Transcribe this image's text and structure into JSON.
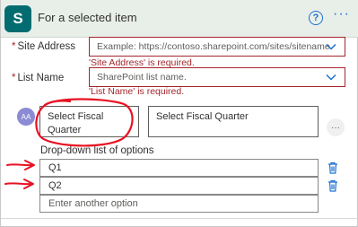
{
  "header": {
    "title": "For a selected item",
    "logo_letter": "S",
    "help_symbol": "?",
    "more_symbol": "···"
  },
  "site_address": {
    "label": "Site Address",
    "required_mark": "*",
    "placeholder": "Example: https://contoso.sharepoint.com/sites/sitename.",
    "error": "'Site Address' is required."
  },
  "list_name": {
    "label": "List Name",
    "required_mark": "*",
    "placeholder": "SharePoint list name.",
    "error": "'List Name' is required."
  },
  "field": {
    "avatar": "AA",
    "name_line1": "Select Fiscal",
    "name_line2": "Quarter",
    "value": "Select Fiscal Quarter",
    "menu_symbol": "···"
  },
  "options": {
    "label": "Drop-down list of options",
    "items": [
      "Q1",
      "Q2"
    ],
    "add_placeholder": "Enter another option"
  },
  "colors": {
    "error": "#a4262c",
    "annotation": "#e81123",
    "accent": "#1f6fd0",
    "sharepoint": "#036c70"
  }
}
